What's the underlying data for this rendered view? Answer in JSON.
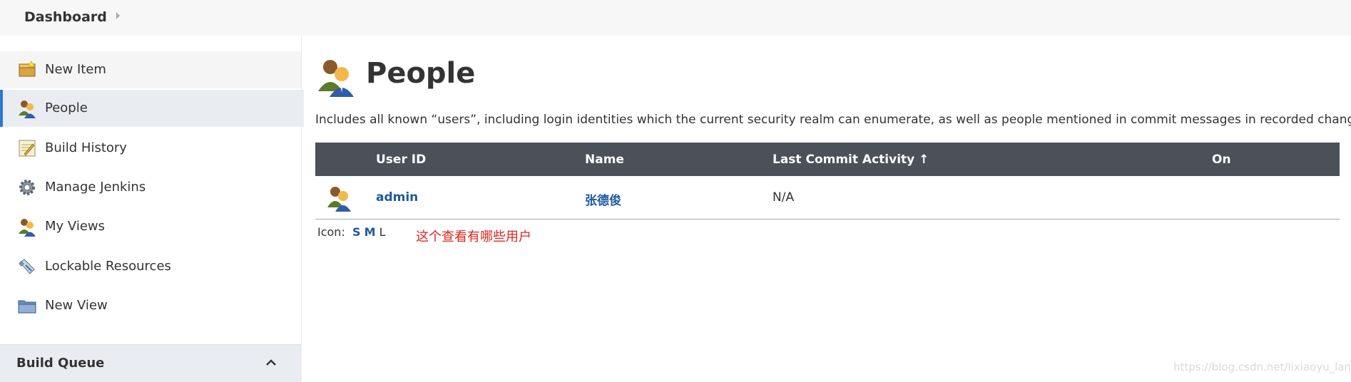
{
  "breadcrumb": {
    "dashboard": "Dashboard"
  },
  "sidebar": {
    "items": [
      {
        "label": "New Item",
        "icon": "new-item-icon"
      },
      {
        "label": "People",
        "icon": "people-icon"
      },
      {
        "label": "Build History",
        "icon": "build-history-icon"
      },
      {
        "label": "Manage Jenkins",
        "icon": "gear-icon"
      },
      {
        "label": "My Views",
        "icon": "people-icon"
      },
      {
        "label": "Lockable Resources",
        "icon": "usb-icon"
      },
      {
        "label": "New View",
        "icon": "folder-icon"
      }
    ],
    "active": "People",
    "build_queue": "Build Queue"
  },
  "page": {
    "title": "People",
    "description": "Includes all known “users”, including login identities which the current security realm can enumerate, as well as people mentioned in commit messages in recorded changelogs."
  },
  "table": {
    "headers": {
      "user_id": "User ID",
      "name": "Name",
      "last_commit": "Last Commit Activity ↑",
      "on": "On"
    },
    "rows": [
      {
        "user_id": "admin",
        "name": "张德俊",
        "last_commit": "N/A",
        "on": ""
      }
    ]
  },
  "icon_sizes": {
    "label": "Icon:",
    "s": "S",
    "m": "M",
    "l": "L"
  },
  "annotation": "这个查看有哪些用户",
  "watermark": "https://blog.csdn.net/lixiaoyu_lang",
  "colors": {
    "header_bg": "#4b5059",
    "link": "#1f5a9e",
    "active_border": "#2b78d0",
    "annotation": "#e0241e"
  }
}
